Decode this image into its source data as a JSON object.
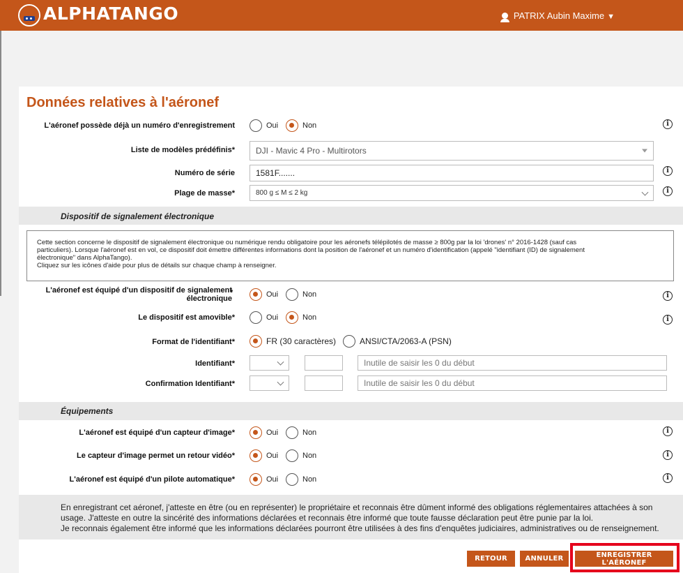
{
  "header": {
    "brand": "ALPHATANGO",
    "user_name": "PATRIX Aubin Maxime",
    "user_caret": "▼"
  },
  "page_title": "Données relatives à l'aéronef",
  "icons": {
    "info": "info-icon",
    "user": "user-icon",
    "logo": "alphatango-logo-icon"
  },
  "colors": {
    "accent": "#c4561a",
    "highlight": "#e5001c",
    "section_bg": "#e8e8e8"
  },
  "form": {
    "registration": {
      "label": "L'aéronef possède déjà un numéro d'enregistrement",
      "yes": "Oui",
      "no": "Non",
      "selected": "Non"
    },
    "model": {
      "label": "Liste de modèles prédéfinis*",
      "value": "DJI - Mavic 4 Pro - Multirotors"
    },
    "serial": {
      "label": "Numéro de série",
      "value": "1581F......."
    },
    "mass": {
      "label": "Plage de masse*",
      "value": "800 g ≤ M ≤ 2 kg"
    }
  },
  "signal_section": {
    "title": "Dispositif de signalement électronique",
    "note_lines": [
      "Cette section concerne le dispositif de signalement électronique ou numérique rendu obligatoire pour les aéronefs télépilotés de masse ≥ 800g par la loi 'drones' n° 2016-1428 (sauf cas",
      "particuliers). Lorsque l'aéronef est en vol, ce dispositif doit émettre différentes informations dont la position de l'aéronef et un numéro d'identification (appelé \"identifiant (ID) de signalement",
      "électronique\" dans AlphaTango).",
      "Cliquez sur les icônes d'aide pour plus de détails sur chaque champ à renseigner."
    ],
    "equipped": {
      "label_l1": "L'aéronef est équipé d'un dispositif de signalement",
      "label_l2": "électronique",
      "yes": "Oui",
      "no": "Non",
      "selected": "Oui"
    },
    "removable": {
      "label": "Le dispositif est amovible*",
      "yes": "Oui",
      "no": "Non",
      "selected": "Non"
    },
    "id_format": {
      "label": "Format de l'identifiant*",
      "option1": "FR (30 caractères)",
      "option2": "ANSI/CTA/2063-A (PSN)",
      "selected": "FR (30 caractères)"
    },
    "identifier": {
      "label": "Identifiant*",
      "placeholder": "Inutile de saisir les 0 du début"
    },
    "confirm": {
      "label": "Confirmation Identifiant*",
      "placeholder": "Inutile de saisir les 0 du début"
    }
  },
  "equip_section": {
    "title": "Équipements",
    "camera": {
      "label": "L'aéronef est équipé d'un capteur d'image*",
      "yes": "Oui",
      "no": "Non",
      "selected": "Oui"
    },
    "video": {
      "label": "Le capteur d'image permet un retour vidéo*",
      "yes": "Oui",
      "no": "Non",
      "selected": "Oui"
    },
    "autopilot": {
      "label": "L'aéronef est équipé d'un pilote automatique*",
      "yes": "Oui",
      "no": "Non",
      "selected": "Oui"
    }
  },
  "disclaimer": {
    "lines": [
      "En enregistrant cet aéronef, j'atteste en être (ou en représenter) le propriétaire et reconnais être dûment informé des obligations réglementaires attachées à son",
      "usage. J'atteste en outre la sincérité des informations déclarées et reconnais être informé que toute fausse déclaration peut être punie par la loi.",
      "Je reconnais également être informé que les informations déclarées pourront être utilisées à des fins d'enquêtes judiciaires, administratives ou de renseignement."
    ]
  },
  "buttons": {
    "back": "RETOUR",
    "cancel": "ANNULER",
    "save": "ENREGISTRER L'AÉRONEF"
  }
}
